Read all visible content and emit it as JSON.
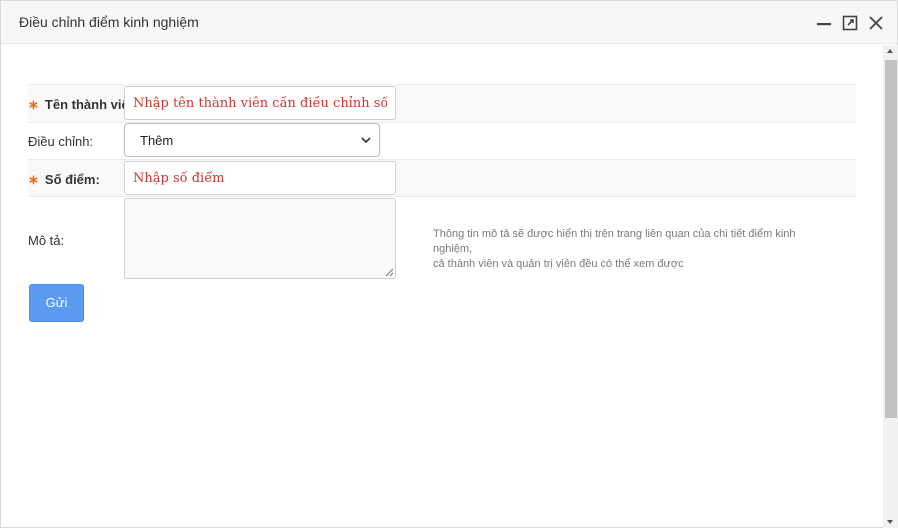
{
  "window": {
    "title": "Điều chỉnh điểm kinh nghiệm",
    "controls": {
      "minimize_icon": "minimize-icon",
      "maximize_icon": "maximize-icon",
      "close_icon": "close-icon"
    }
  },
  "form": {
    "member": {
      "required_mark": "∗",
      "label": "Tên thành viên:",
      "placeholder": "Nhập tên thành viên cần điều chỉnh số điểm kinh nghiệm",
      "value": ""
    },
    "adjust": {
      "label": "Điều chỉnh:",
      "selected": "Thêm"
    },
    "points": {
      "required_mark": "∗",
      "label": "Số điểm:",
      "placeholder": "Nhập số điểm",
      "value": ""
    },
    "description": {
      "label": "Mô tả:",
      "value": "",
      "hint_line1": "Thông tin mô tả sẽ được hiển thị trên trang liên quan của chi tiết điểm kinh nghiệm,",
      "hint_line2": "cả thành viên và quản trị viên đều có thể xem được"
    },
    "submit_label": "Gửi"
  },
  "colors": {
    "accent": "#5b9cf2",
    "required": "#e8701a",
    "placeholder": "#d0352f"
  }
}
